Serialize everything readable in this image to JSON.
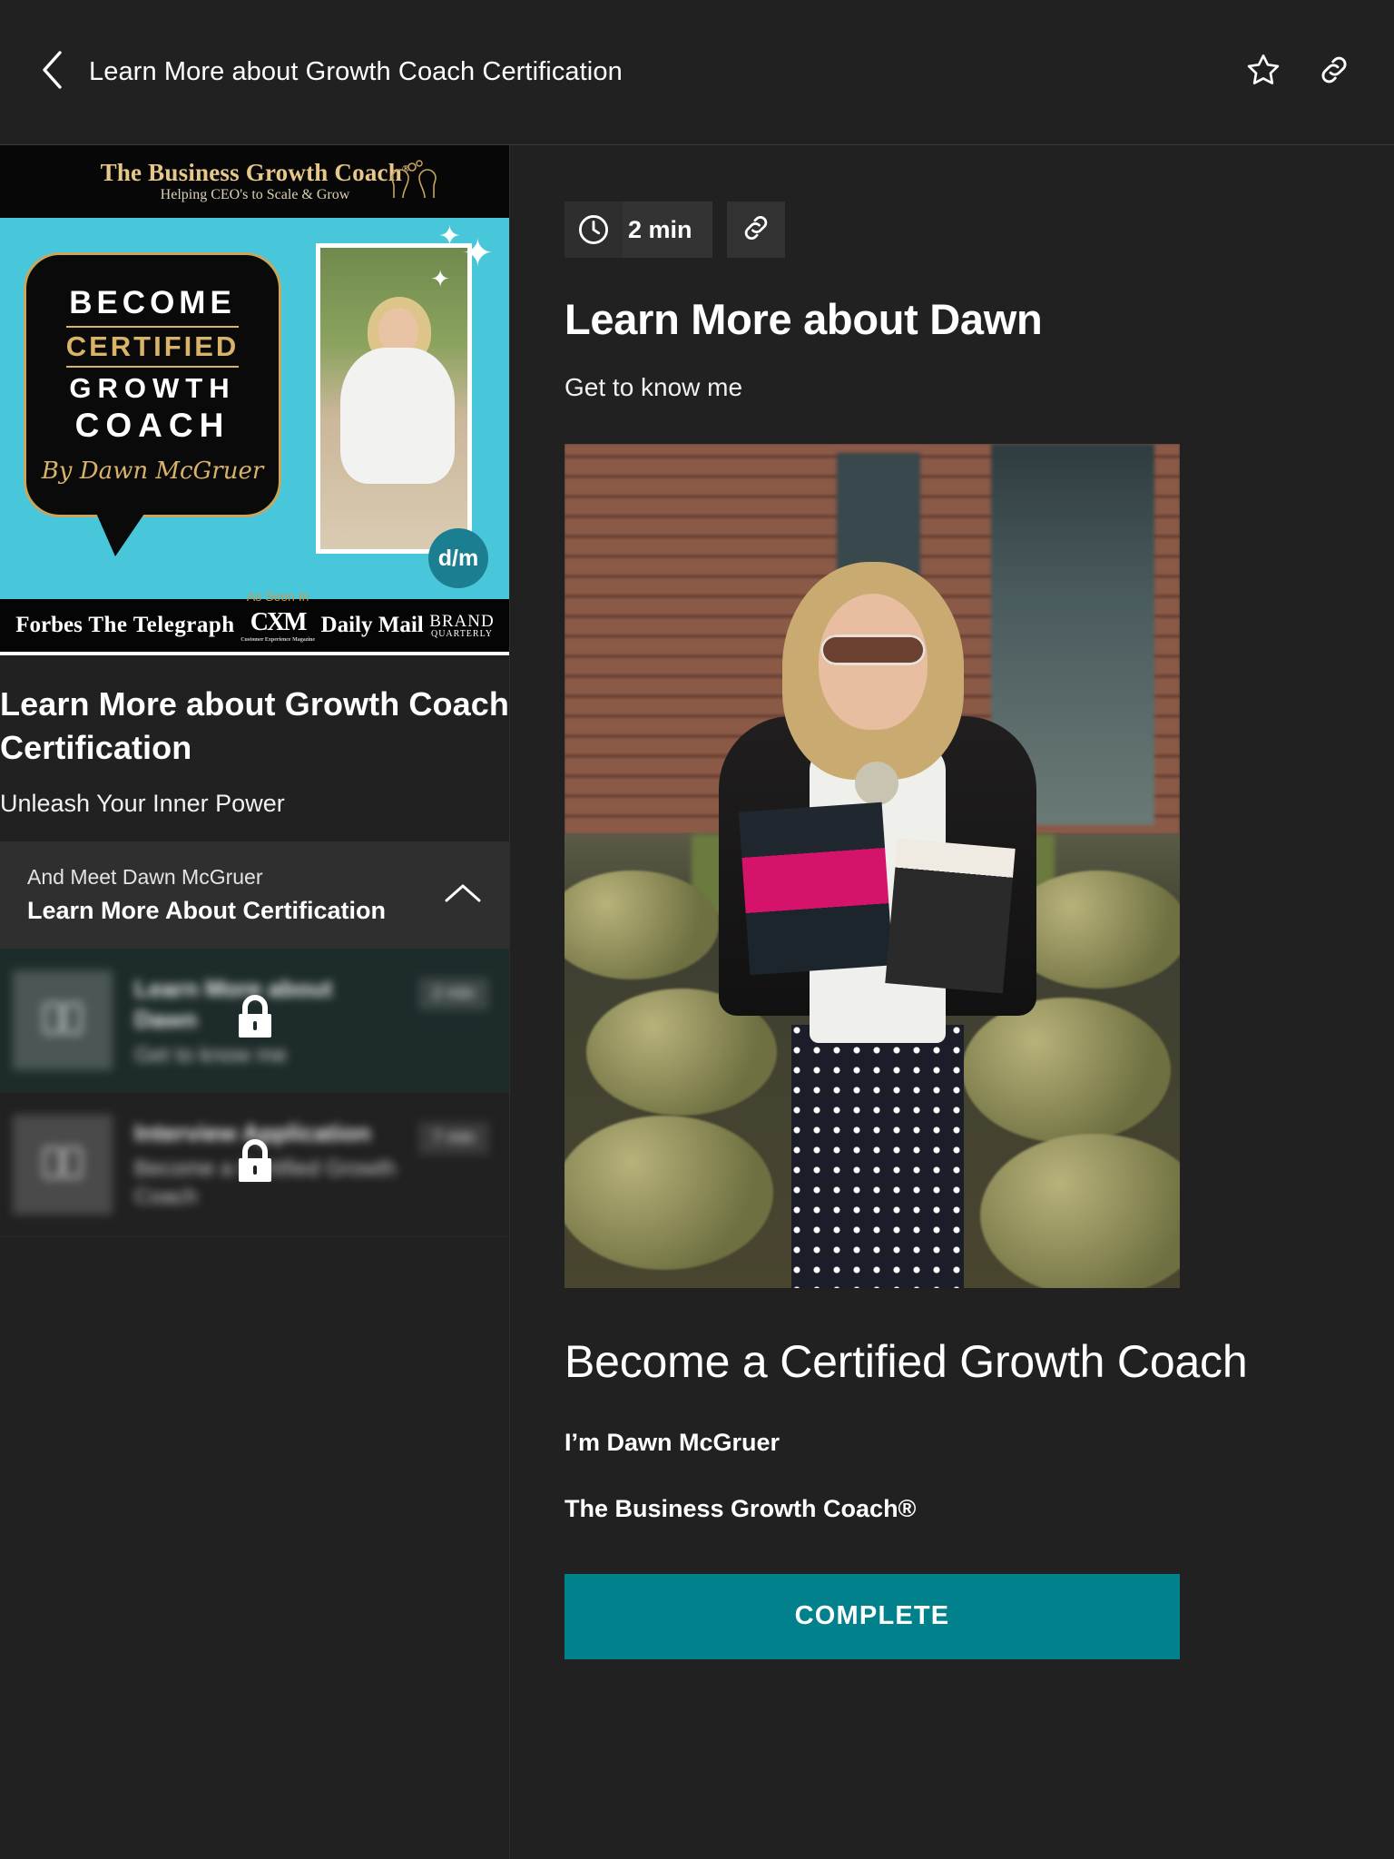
{
  "appbar": {
    "title": "Learn More about Growth Coach Certification",
    "back_icon": "chevron-left-icon",
    "favorite_icon": "star-outline-icon",
    "share_icon": "link-icon"
  },
  "sidebar": {
    "promo": {
      "brand_line1": "The Business Growth Coach",
      "brand_trademark": "®",
      "brand_line2": "Helping CEO's to Scale & Grow",
      "bubble_line1": "BECOME",
      "bubble_line2": "CERTIFIED",
      "bubble_line3": "GROWTH",
      "bubble_line4": "COACH",
      "bubble_byline": "By Dawn McGruer",
      "avatar_badge": "d/m",
      "as_seen_in": "As Seen In",
      "press": [
        {
          "name": "Forbes"
        },
        {
          "name": "The Telegraph"
        },
        {
          "name": "CXM",
          "sub": "Customer Experience Magazine"
        },
        {
          "name": "Daily Mail"
        },
        {
          "name": "BRAND",
          "sub": "QUARTERLY"
        }
      ]
    },
    "course_title": "Learn More about Growth Coach Certification",
    "course_subtitle": "Unleash Your Inner Power",
    "section": {
      "kicker": "And Meet Dawn McGruer",
      "name": "Learn More About Certification",
      "collapse_icon": "chevron-up-icon"
    },
    "lessons": [
      {
        "title": "Learn More about Dawn",
        "desc": "Get to know me",
        "duration": "2 min",
        "locked": true,
        "active": true,
        "thumb_icon": "book-icon",
        "lock_icon": "lock-icon"
      },
      {
        "title": "Interview Application",
        "desc": "Become a Certified Growth Coach",
        "duration": "7 min",
        "locked": true,
        "active": false,
        "thumb_icon": "book-icon",
        "lock_icon": "lock-icon"
      }
    ]
  },
  "content": {
    "duration": "2 min",
    "clock_icon": "clock-icon",
    "link_icon": "link-icon",
    "heading": "Learn More about Dawn",
    "subheading": "Get to know me",
    "hero_image_alt": "Dawn McGruer holding books outdoors",
    "hero_title": "Become a Certified Growth Coach",
    "hero_line1": "I’m Dawn McGruer",
    "hero_line2": "The Business Growth Coach®",
    "complete_label": "COMPLETE"
  },
  "colors": {
    "background": "#212121",
    "panel": "#2f2f2f",
    "accent_teal": "#00818c",
    "active_lesson": "#1d2b2b",
    "promo_cyan": "#49c7da",
    "promo_gold": "#d9b468"
  }
}
